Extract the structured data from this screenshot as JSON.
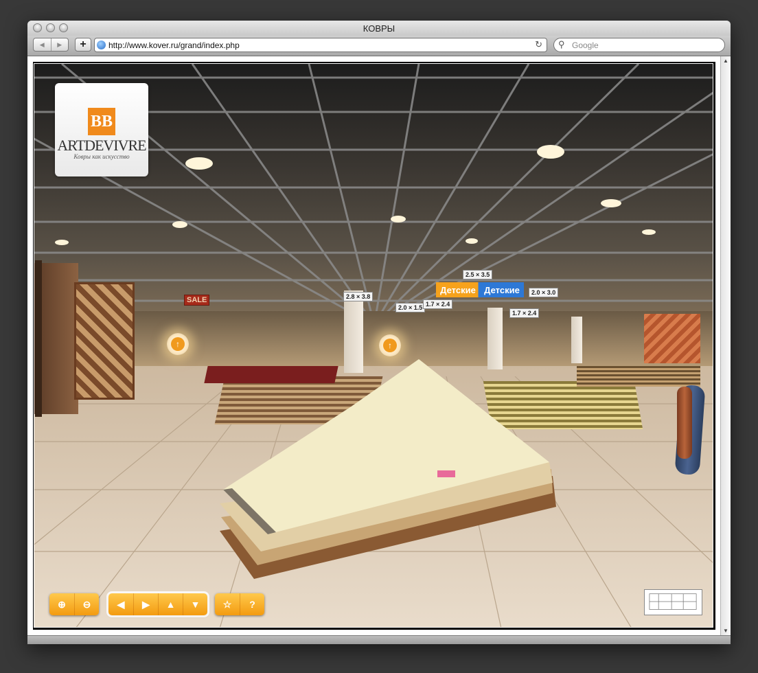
{
  "window": {
    "title": "КОВРЫ"
  },
  "toolbar": {
    "back_icon": "back-arrow-icon",
    "forward_icon": "forward-arrow-icon",
    "add_bookmark_label": "+",
    "url": "http://www.kover.ru/grand/index.php",
    "search_placeholder": "Google"
  },
  "logo": {
    "mark": "BB",
    "name": "ARTDEVIVRE",
    "tagline": "Ковры как искусство"
  },
  "signs": [
    "2.5 × 3.5",
    "2.0 × 3.0",
    "2.8 × 3.8",
    "2.0 × 1.5",
    "1.7 × 2.4",
    "1.7 × 2.4",
    "SALE"
  ],
  "kids_sign": {
    "left": "Детские",
    "right": "Детские"
  },
  "controls": {
    "zoom": [
      {
        "name": "zoom-in-icon",
        "glyph": "⊕"
      },
      {
        "name": "zoom-out-icon",
        "glyph": "⊖"
      }
    ],
    "nav": [
      {
        "name": "pan-left-icon",
        "glyph": "◀"
      },
      {
        "name": "pan-right-icon",
        "glyph": "▶"
      },
      {
        "name": "pan-up-icon",
        "glyph": "▲"
      },
      {
        "name": "pan-down-icon",
        "glyph": "▼"
      }
    ],
    "extra": [
      {
        "name": "favorite-star-icon",
        "glyph": "☆"
      },
      {
        "name": "help-icon",
        "glyph": "?"
      }
    ]
  },
  "colors": {
    "accent": "#f39b10",
    "accent_light": "#ffc94c",
    "logo_orange": "#f08a1c"
  }
}
